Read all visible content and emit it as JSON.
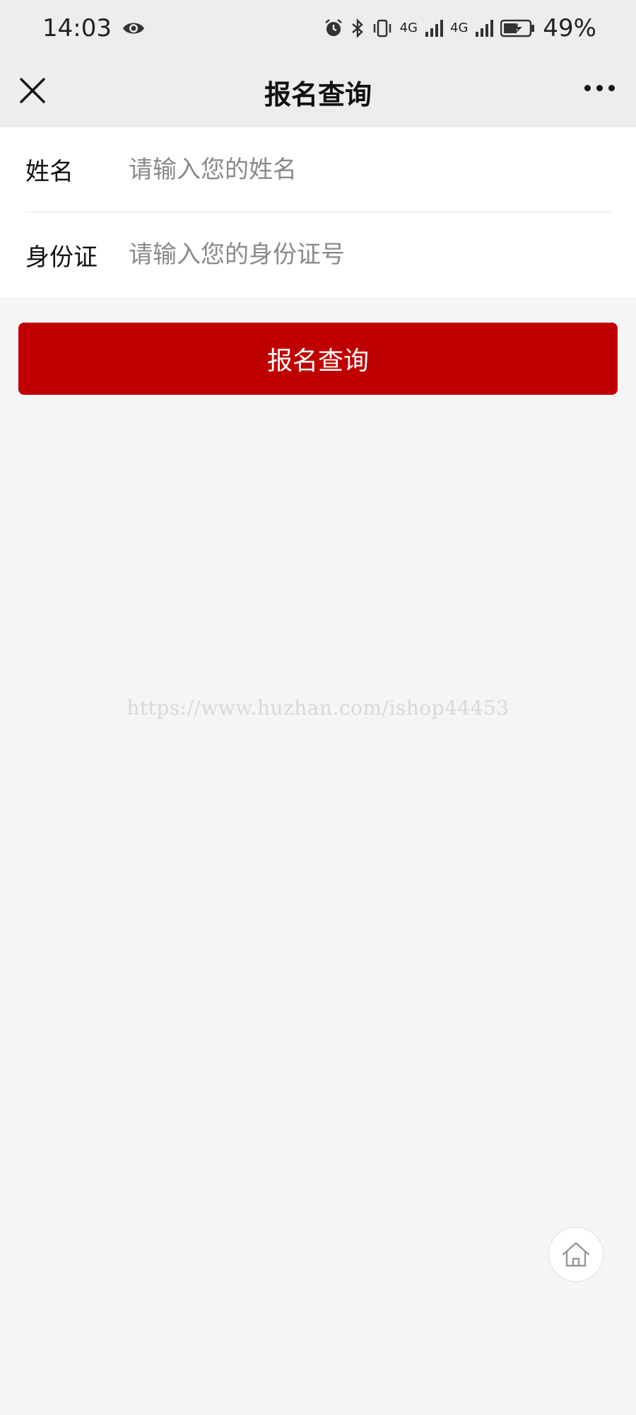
{
  "status_bar": {
    "time": "14:03",
    "network_1": "4G",
    "network_2": "4G",
    "battery": "49%"
  },
  "nav": {
    "title": "报名查询"
  },
  "form": {
    "name_label": "姓名",
    "name_placeholder": "请输入您的姓名",
    "id_label": "身份证",
    "id_placeholder": "请输入您的身份证号"
  },
  "actions": {
    "submit_label": "报名查询"
  },
  "watermark": "https://www.huzhan.com/ishop44453",
  "colors": {
    "accent": "#c00000",
    "background": "#f5f5f5",
    "bar": "#ededed"
  }
}
